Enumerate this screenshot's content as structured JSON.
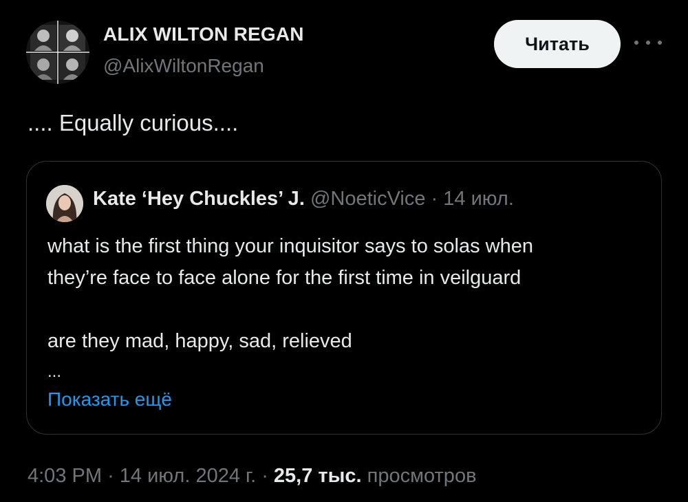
{
  "tweet": {
    "author": {
      "name": "ALIX WILTON REGAN",
      "handle": "@AlixWiltonRegan"
    },
    "follow_label": "Читать",
    "text": ".... Equally curious....",
    "quote": {
      "author_name": "Kate ‘Hey Chuckles’ J.",
      "handle": "@NoeticVice",
      "separator": "·",
      "date": "14 июл.",
      "body_line1": "what is the first thing your inquisitor says to solas when",
      "body_line2": "they’re face to face alone for the first time in veilguard",
      "body_line3": "are they mad, happy, sad, relieved",
      "ellipsis": "...",
      "show_more": "Показать ещё"
    },
    "meta": {
      "time": "4:03 PM",
      "sep1": "·",
      "date": "14 июл. 2024 г.",
      "sep2": "·",
      "views_count": "25,7 тыс.",
      "views_label": "просмотров"
    }
  },
  "colors": {
    "background": "#000000",
    "text_primary": "#e7e9ea",
    "text_secondary": "#71767b",
    "link": "#1d9bf0",
    "border": "#2f3336"
  }
}
